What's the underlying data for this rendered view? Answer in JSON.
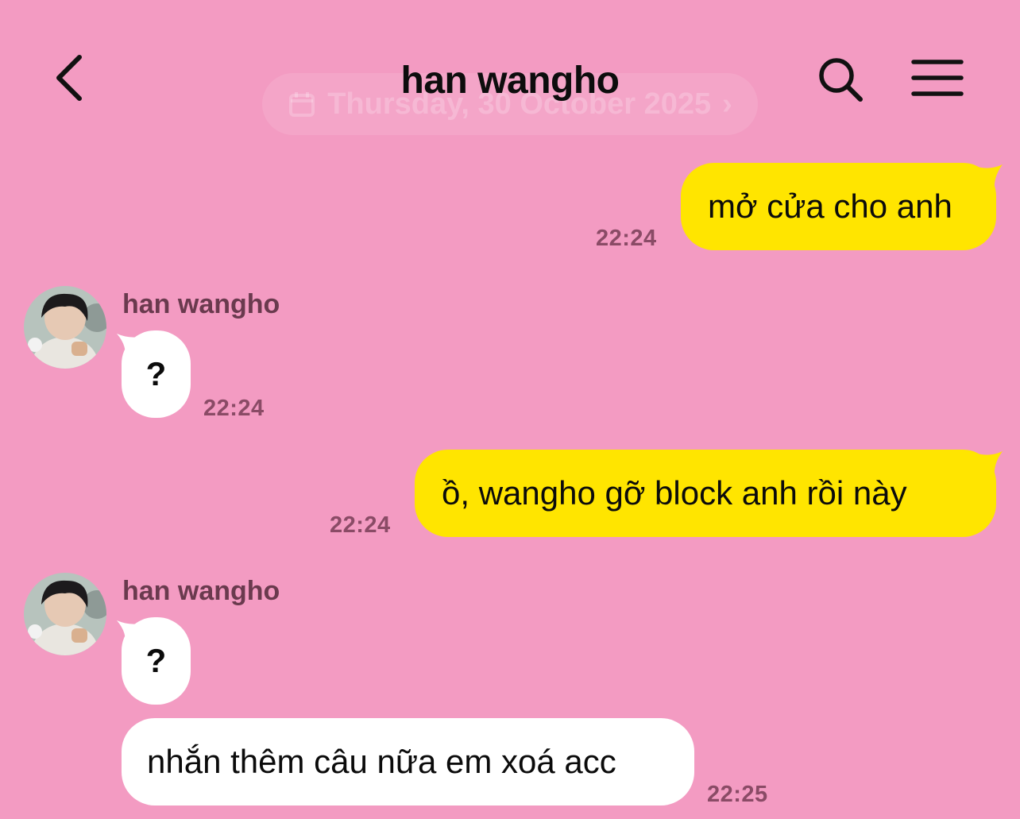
{
  "header": {
    "title": "han wangho",
    "back_icon": "chevron-left-icon",
    "search_icon": "search-icon",
    "menu_icon": "hamburger-menu-icon"
  },
  "date_pill": {
    "label": "Thursday, 30 October 2025",
    "icon": "calendar-icon",
    "chevron": "›"
  },
  "colors": {
    "background": "#f39bc2",
    "my_bubble": "#ffe500",
    "their_bubble": "#ffffff"
  },
  "messages": [
    {
      "from": "me",
      "text": "mở cửa cho anh",
      "time": "22:24"
    },
    {
      "from": "them",
      "sender": "han wangho",
      "text": "?",
      "time": "22:24"
    },
    {
      "from": "me",
      "text": "ồ, wangho gỡ block anh rồi này",
      "time": "22:24"
    },
    {
      "from": "them",
      "sender": "han wangho",
      "text": "?",
      "time": ""
    },
    {
      "from": "them",
      "text": "nhắn thêm câu nữa em xoá acc",
      "time": "22:25"
    }
  ]
}
